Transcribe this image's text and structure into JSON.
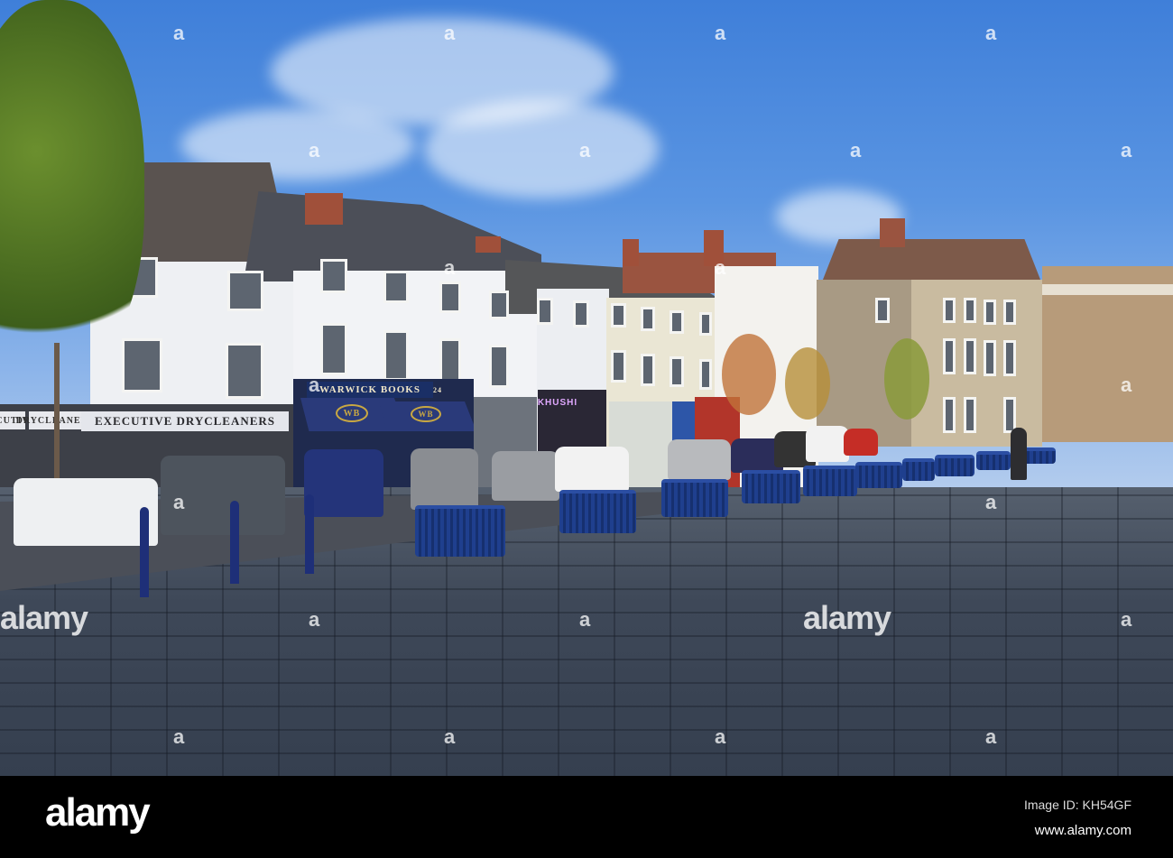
{
  "photo": {
    "signs": {
      "drycleaners": "EXECUTIVE DRYCLEANERS",
      "drycleaners_side": "DRYCLEANERS",
      "drycleaners_corner": "ECUTIVE",
      "bookshop": "WARWICK BOOKS",
      "bookshop_number": "24",
      "bookshop_logo": "WB",
      "restaurant": "KHUSHI"
    }
  },
  "watermark": {
    "mark": "a",
    "word": "alamy"
  },
  "footer": {
    "logo": "alamy",
    "image_id": "Image ID: KH54GF",
    "url": "www.alamy.com"
  },
  "colors": {
    "sky": "#4a86dc",
    "paving": "#3e4858",
    "planter": "#1f3f8e"
  }
}
